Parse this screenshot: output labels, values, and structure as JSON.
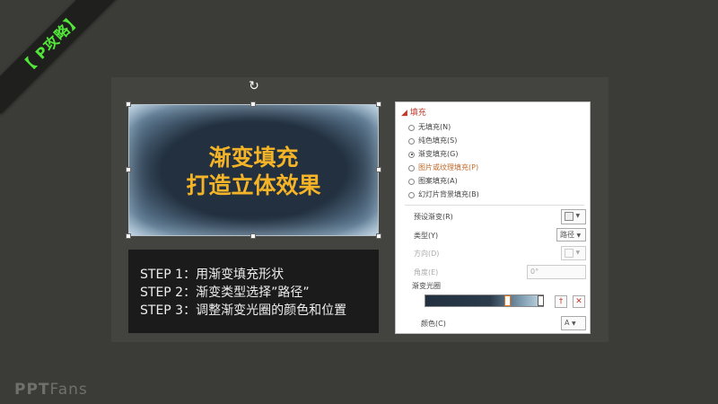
{
  "ribbon": {
    "label": "【 P攻略】"
  },
  "slide": {
    "title_line1": "渐变填充",
    "title_line2": "打造立体效果",
    "rotate_glyph": "↻",
    "steps": [
      "STEP 1：用渐变填充形状",
      "STEP 2：渐变类型选择”路径”",
      "STEP 3：调整渐变光圈的颜色和位置"
    ]
  },
  "panel": {
    "header": "◢ 填充",
    "options": [
      {
        "label": "无填充(N)",
        "selected": false
      },
      {
        "label": "纯色填充(S)",
        "selected": false
      },
      {
        "label": "渐变填充(G)",
        "selected": true
      },
      {
        "label": "图片或纹理填充(P)",
        "selected": false
      },
      {
        "label": "图案填充(A)",
        "selected": false
      },
      {
        "label": "幻灯片背景填充(B)",
        "selected": false
      }
    ],
    "preset_label": "预设渐变(R)",
    "type_label": "类型(Y)",
    "type_value": "路径",
    "direction_label": "方向(D)",
    "angle_label": "角度(E)",
    "angle_value": "0°",
    "stops_label": "渐变光圈",
    "color_label": "颜色(C)",
    "add_stop_glyph": "†",
    "remove_stop_glyph": "✕",
    "color_glyph": "A"
  },
  "brand": {
    "part1": "PPT",
    "part2": "Fans"
  },
  "colors": {
    "accent_title": "#f5b427",
    "ribbon_text": "#52e63a",
    "panel_accent": "#c0392b"
  }
}
